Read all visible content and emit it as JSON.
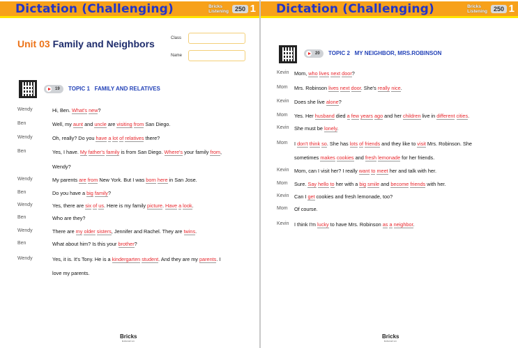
{
  "header": {
    "title": "Dictation (Challenging)",
    "brand_line1": "Bricks",
    "brand_line2": "Listening",
    "level": "250",
    "book": "1",
    "colors": {
      "bar": "#f7a11a",
      "stripe": "#ffe400",
      "title": "#2235c8",
      "blank": "#e8262c"
    }
  },
  "page1": {
    "unit_label": "Unit 03",
    "unit_title": "Family and Neighbors",
    "class_label": "Class",
    "name_label": "Name",
    "class_value": "",
    "name_value": "",
    "track": "19",
    "topic": "TOPIC 1   FAMILY AND RELATIVES",
    "lines": [
      {
        "speaker": "Wendy",
        "text": "Hi, Ben. [What's] [new]?"
      },
      {
        "speaker": "Ben",
        "text": "Well, my [aunt] and [uncle] are [visiting] [from] San Diego."
      },
      {
        "speaker": "Wendy",
        "text": "Oh, really? Do you [have] [a] [lot] [of] [relatives] there?"
      },
      {
        "speaker": "Ben",
        "text": "Yes, I have. [My] [father's] [family] is from San Diego. [Where's] your family [from],"
      },
      {
        "speaker": "",
        "text": "Wendy?"
      },
      {
        "speaker": "Wendy",
        "text": "My parents [are] [from] New York. But I was [born] [here] in San Jose."
      },
      {
        "speaker": "Ben",
        "text": "Do you have a [big] [family]?"
      },
      {
        "speaker": "Wendy",
        "text": "Yes, there are [six] [of] [us]. Here is my family [picture]. [Have] [a] [look]."
      },
      {
        "speaker": "Ben",
        "text": "Who are they?"
      },
      {
        "speaker": "Wendy",
        "text": "There are [my] [older] [sisters], Jennifer and Rachel. They are [twins]."
      },
      {
        "speaker": "Ben",
        "text": "What about him? Is this your [brother]?"
      },
      {
        "speaker": "Wendy",
        "text": "Yes, it is. It's Tony. He is a [kindergarten] [student]. And they are my [parents]. I"
      },
      {
        "speaker": "",
        "text": "love my parents."
      }
    ],
    "footer_logo": "Bricks",
    "footer_sub": "Education"
  },
  "page2": {
    "track": "20",
    "topic": "TOPIC 2   MY NEIGHBOR, MRS.ROBINSON",
    "lines": [
      {
        "speaker": "Kevin",
        "text": "Mom, [who] [lives] [next] [door]?"
      },
      {
        "speaker": "Mom",
        "text": "Mrs. Robinson [lives] [next] [door]. She's [really] [nice]."
      },
      {
        "speaker": "Kevin",
        "text": "Does she live [alone]?"
      },
      {
        "speaker": "Mom",
        "text": "Yes. Her [husband] died [a] [few] [years] [ago] and her [children] live in [different] [cities]."
      },
      {
        "speaker": "Kevin",
        "text": "She must be [lonely]."
      },
      {
        "speaker": "Mom",
        "text": "I [don't] [think] [so]. She has [lots] [of] [friends] and they like to [visit] Mrs. Robinson. She"
      },
      {
        "speaker": "",
        "text": "sometimes [makes] [cookies] and [fresh] [lemonade] for her friends."
      },
      {
        "speaker": "Kevin",
        "text": "Mom, can I visit her? I really [want] [to] [meet] her and talk with her."
      },
      {
        "speaker": "Mom",
        "text": "Sure. [Say] [hello] [to] her with a [big] [smile] and [become] [friends] with her."
      },
      {
        "speaker": "Kevin",
        "text": "Can I [get] cookies and fresh lemonade, too?"
      },
      {
        "speaker": "Mom",
        "text": "Of course."
      },
      {
        "speaker": "Kevin",
        "text": "I think I'm [lucky] to have Mrs. Robinson [as] [a] [neighbor]."
      }
    ],
    "footer_logo": "Bricks",
    "footer_sub": "Education"
  }
}
